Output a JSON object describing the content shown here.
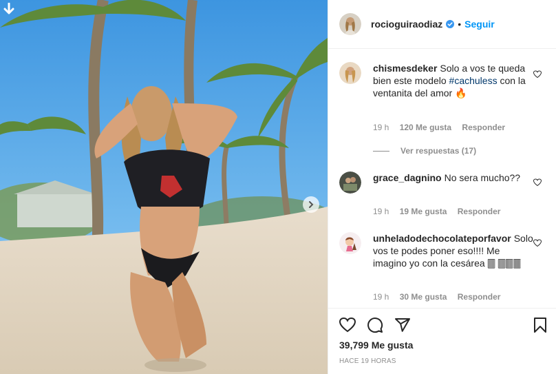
{
  "header": {
    "username": "rocioguiraodiaz",
    "separator": "•",
    "follow_label": "Seguir"
  },
  "comments": [
    {
      "username": "chismesdeker",
      "text_before": "Solo a vos te queda bien este modelo",
      "hashtag": "#cachuless",
      "text_after": "con la ventanita del amor 🔥",
      "time": "19 h",
      "likes": "120 Me gusta",
      "reply_label": "Responder",
      "view_replies": "Ver respuestas (17)"
    },
    {
      "username": "grace_dagnino",
      "text": "No sera mucho??",
      "time": "19 h",
      "likes": "19 Me gusta",
      "reply_label": "Responder"
    },
    {
      "username": "unheladodechocolateporfavor",
      "text": "Solo vos te podes poner eso!!!! Me imagino yo con la cesárea 🀫 🀫🀫🀫",
      "time": "19 h",
      "likes": "30 Me gusta",
      "reply_label": "Responder"
    }
  ],
  "footer": {
    "likes": "39,799 Me gusta",
    "time": "HACE 19 HORAS"
  },
  "icons": {
    "like": "heart-icon",
    "comment": "comment-icon",
    "share": "share-icon",
    "save": "bookmark-icon",
    "verified": "verified-badge-icon",
    "download": "download-arrow-icon",
    "next": "chevron-right-icon"
  },
  "colors": {
    "accent": "#0095f6",
    "muted": "#8e8e8e",
    "text": "#262626",
    "hashtag": "#00376b"
  }
}
